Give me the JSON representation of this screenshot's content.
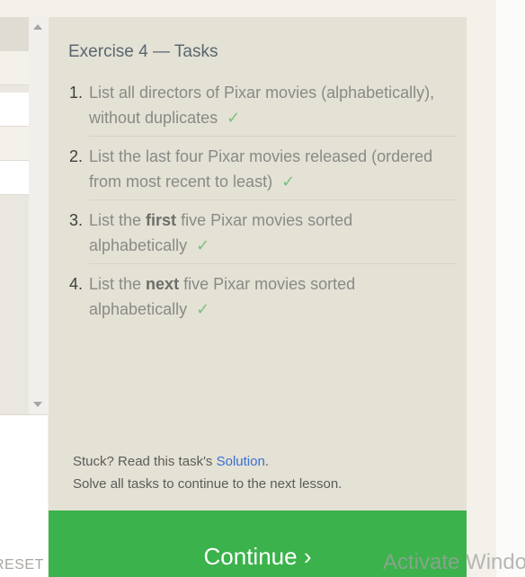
{
  "panel": {
    "title": "Exercise 4 — Tasks",
    "tasks": [
      {
        "number": "1.",
        "pre": "List all directors of Pixar movies (alphabetically), without duplicates",
        "bold": "",
        "post": "",
        "check": "✓"
      },
      {
        "number": "2.",
        "pre": "List the last four Pixar movies released (ordered from most recent to least)",
        "bold": "",
        "post": "",
        "check": "✓"
      },
      {
        "number": "3.",
        "pre": "List the ",
        "bold": "first",
        "post": " five Pixar movies sorted alphabetically",
        "check": "✓"
      },
      {
        "number": "4.",
        "pre": "List the ",
        "bold": "next",
        "post": " five Pixar movies sorted alphabetically",
        "check": "✓"
      }
    ],
    "footer": {
      "stuck_prefix": "Stuck? Read this task's ",
      "solution_link": "Solution",
      "stuck_suffix": ".",
      "solve_all": "Solve all tasks to continue to the next lesson."
    },
    "continue_label": "Continue ›"
  },
  "editor": {
    "reset_label": "RESET"
  },
  "watermark": "Activate Windows",
  "colors": {
    "accent_green": "#3bb24b",
    "check_green": "#7cc07e",
    "link_blue": "#3a6fd1",
    "panel_bg": "#e4e1d5"
  }
}
